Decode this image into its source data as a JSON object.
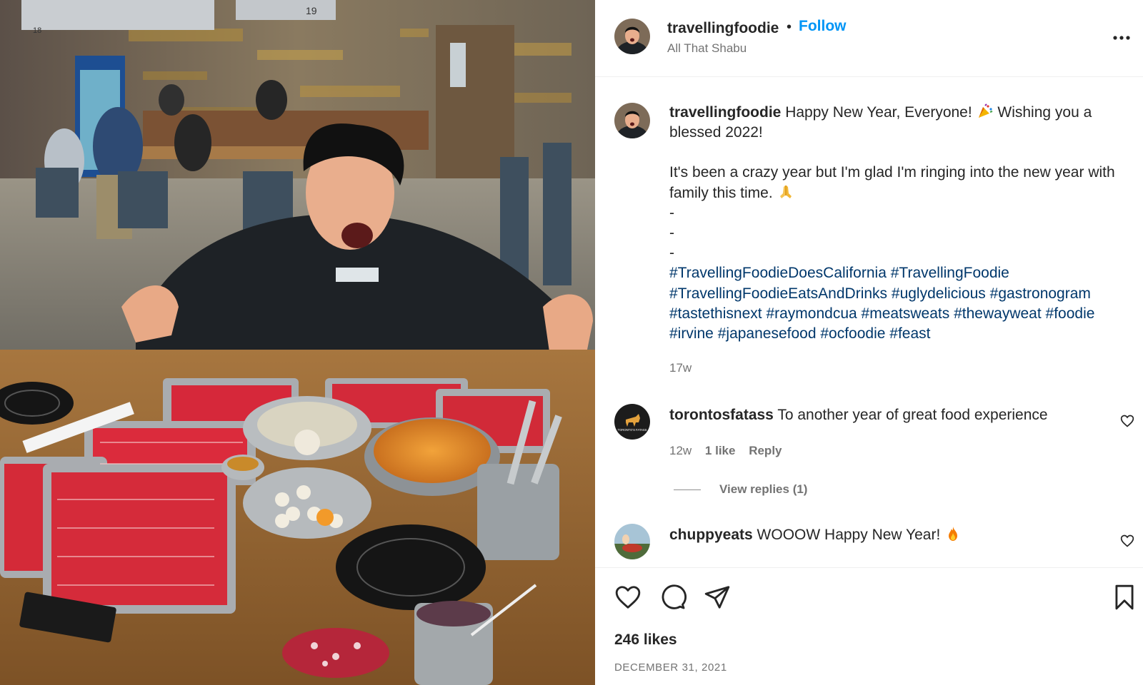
{
  "post": {
    "username": "travellingfoodie",
    "location": "All That Shabu",
    "follow_label": "Follow",
    "separator": "•",
    "caption": {
      "line1": "Happy New Year, Everyone!",
      "line1b": "Wishing you a blessed 2022!",
      "line2": "It's been a crazy year but I'm glad I'm ringing into the new year with family this time.",
      "dashes": [
        "-",
        "-",
        "-"
      ],
      "hashtags": [
        "#TravellingFoodieDoesCalifornia",
        "#TravellingFoodie",
        "#TravellingFoodieEatsAndDrinks",
        "#uglydelicious",
        "#gastronogram",
        "#tastethisnext",
        "#raymondcua",
        "#meatsweats",
        "#thewayweat",
        "#foodie",
        "#irvine",
        "#japanesefood",
        "#ocfoodie",
        "#feast"
      ]
    },
    "caption_time": "17w",
    "likes": "246 likes",
    "date": "DECEMBER 31, 2021"
  },
  "comments": [
    {
      "username": "torontosfatass",
      "text": "To another year of great food experience",
      "time": "12w",
      "likes": "1 like",
      "reply_label": "Reply",
      "view_replies": "View replies (1)",
      "avatar_text": "TORONTO'S FATASS"
    },
    {
      "username": "chuppyeats",
      "text": "WOOOW Happy New Year!"
    }
  ],
  "photo_signs": {
    "left": "18",
    "right": "19"
  },
  "icons": {
    "more": "more-options-icon",
    "like": "heart-icon",
    "comment": "comment-bubble-icon",
    "share": "paper-plane-icon",
    "save": "bookmark-icon"
  },
  "colors": {
    "link": "#0095f6",
    "hashtag": "#00376b",
    "meta": "#737373",
    "text": "#262626"
  }
}
